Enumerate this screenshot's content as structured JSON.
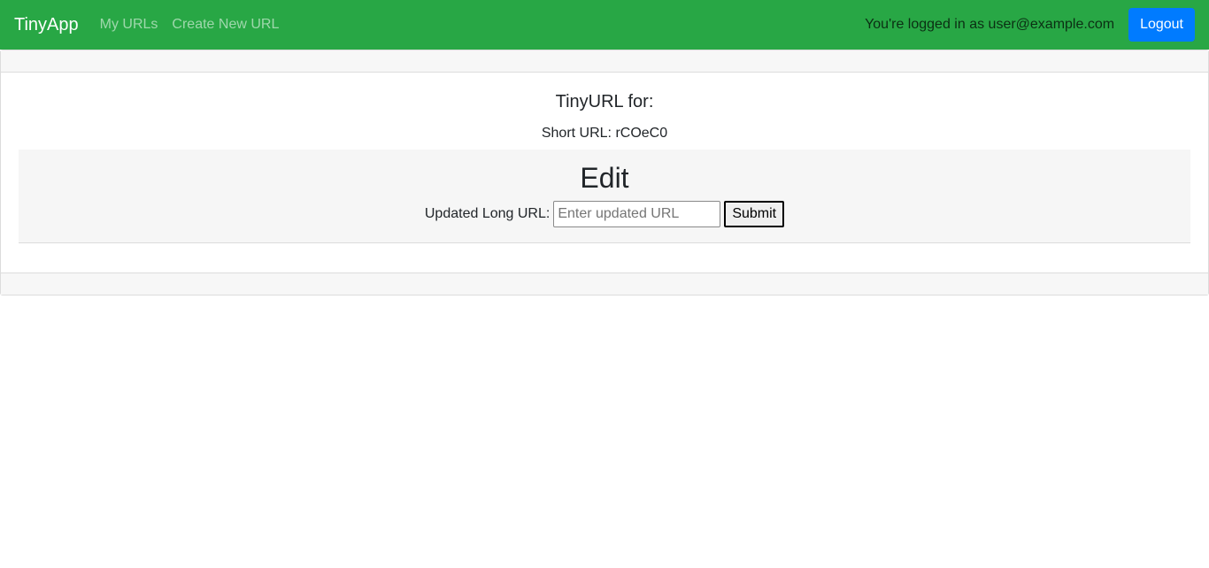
{
  "navbar": {
    "brand": "TinyApp",
    "links": [
      "My URLs",
      "Create New URL"
    ],
    "login_text": "You're logged in as user@example.com",
    "logout_label": "Logout",
    "bg_color": "#28a745",
    "button_color": "#007bff"
  },
  "main": {
    "heading": "TinyURL for:",
    "short_url_text": "Short URL: rCOeC0",
    "edit": {
      "title": "Edit",
      "field_label": "Updated Long URL:",
      "input_value": "",
      "input_placeholder": "Enter updated URL",
      "submit_label": "Submit"
    }
  }
}
